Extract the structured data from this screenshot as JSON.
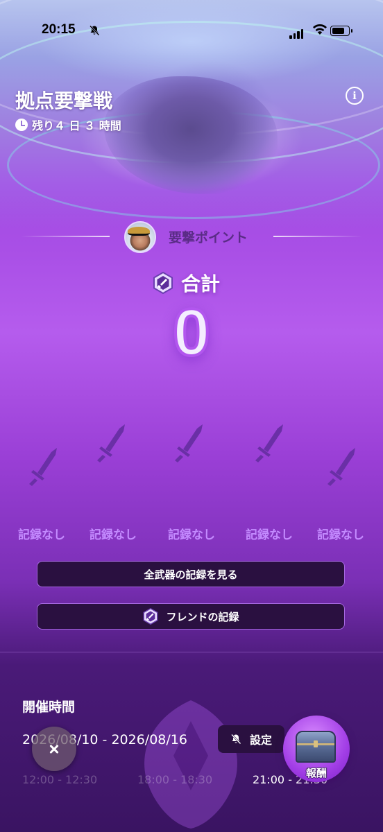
{
  "status_bar": {
    "time": "20:15"
  },
  "event": {
    "title": "拠点要撃戦",
    "remaining": "残り４ 日 ３ 時間",
    "info_icon": "i"
  },
  "points": {
    "section_label": "要撃ポイント",
    "total_label": "合計",
    "total_value": "0"
  },
  "weapons": [
    {
      "record": "記録なし",
      "icon": "sword-icon"
    },
    {
      "record": "記録なし",
      "icon": "sword-icon"
    },
    {
      "record": "記録なし",
      "icon": "sword-icon"
    },
    {
      "record": "記録なし",
      "icon": "sword-icon"
    },
    {
      "record": "記録なし",
      "icon": "sword-icon"
    }
  ],
  "buttons": {
    "all_weapons": "全武器の記録を見る",
    "friends": "フレンドの記録"
  },
  "schedule": {
    "title": "開催時間",
    "dates": "2026/08/10 - 2026/08/16",
    "notify_label": "設定",
    "slots": [
      "12:00 - 12:30",
      "18:00 - 18:30",
      "21:00 - 21:30"
    ]
  },
  "reward": {
    "label": "報酬"
  },
  "colors": {
    "accent": "#b55ced",
    "button_bg": "#2a1040",
    "record_text": "#c48bff"
  }
}
